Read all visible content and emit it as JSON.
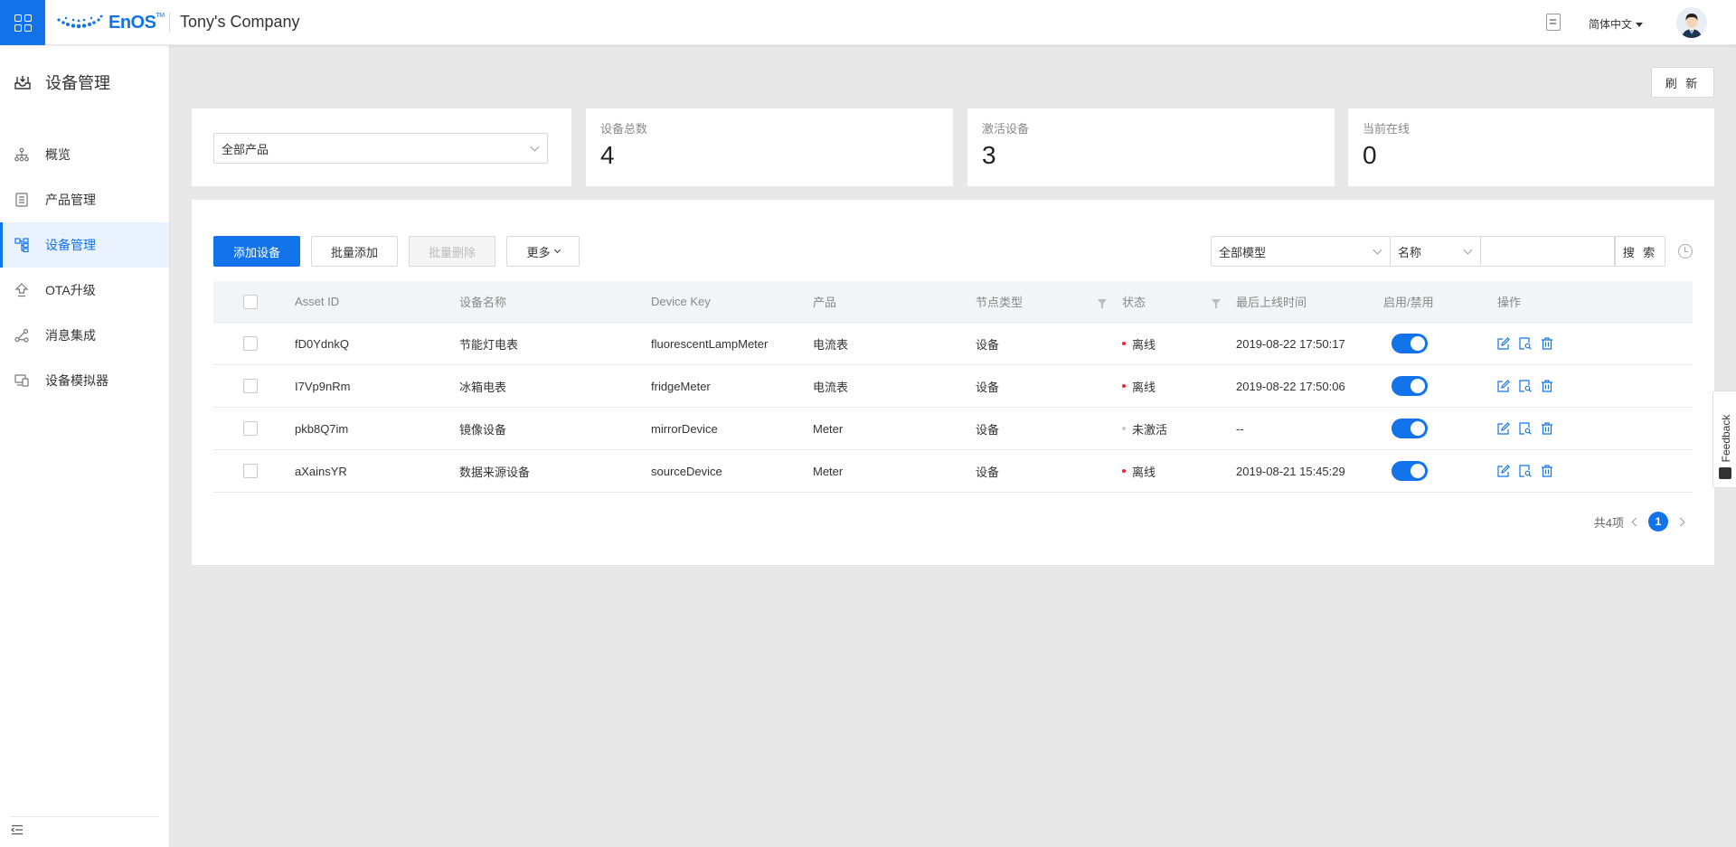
{
  "topbar": {
    "brand": "EnOS",
    "company": "Tony's Company",
    "language": "简体中文"
  },
  "sidebar": {
    "title": "设备管理",
    "items": [
      {
        "label": "概览",
        "icon": "sitemap-icon",
        "active": false
      },
      {
        "label": "产品管理",
        "icon": "list-icon",
        "active": false
      },
      {
        "label": "设备管理",
        "icon": "device-tree-icon",
        "active": true
      },
      {
        "label": "OTA升级",
        "icon": "upload-icon",
        "active": false
      },
      {
        "label": "消息集成",
        "icon": "share-icon",
        "active": false
      },
      {
        "label": "设备模拟器",
        "icon": "devices-icon",
        "active": false
      }
    ]
  },
  "main": {
    "refresh_label": "刷 新",
    "product_filter": "全部产品",
    "stats": [
      {
        "label": "设备总数",
        "value": "4"
      },
      {
        "label": "激活设备",
        "value": "3"
      },
      {
        "label": "当前在线",
        "value": "0"
      }
    ]
  },
  "toolbar": {
    "add_device": "添加设备",
    "batch_add": "批量添加",
    "batch_delete": "批量删除",
    "more": "更多",
    "model_filter": "全部模型",
    "search_field": "名称",
    "search_value": "",
    "search_button": "搜 索"
  },
  "table": {
    "columns": [
      "Asset ID",
      "设备名称",
      "Device Key",
      "产品",
      "节点类型",
      "状态",
      "最后上线时间",
      "启用/禁用",
      "操作"
    ],
    "rows": [
      {
        "asset_id": "fD0YdnkQ",
        "name": "节能灯电表",
        "device_key": "fluorescentLampMeter",
        "product": "电流表",
        "node_type": "设备",
        "status": "离线",
        "status_color": "#f5222d",
        "last_online": "2019-08-22 17:50:17",
        "enabled": true
      },
      {
        "asset_id": "I7Vp9nRm",
        "name": "冰箱电表",
        "device_key": "fridgeMeter",
        "product": "电流表",
        "node_type": "设备",
        "status": "离线",
        "status_color": "#f5222d",
        "last_online": "2019-08-22 17:50:06",
        "enabled": true
      },
      {
        "asset_id": "pkb8Q7im",
        "name": "镜像设备",
        "device_key": "mirrorDevice",
        "product": "Meter",
        "node_type": "设备",
        "status": "未激活",
        "status_color": "#c8c8c8",
        "last_online": "--",
        "enabled": true
      },
      {
        "asset_id": "aXainsYR",
        "name": "数据来源设备",
        "device_key": "sourceDevice",
        "product": "Meter",
        "node_type": "设备",
        "status": "离线",
        "status_color": "#f5222d",
        "last_online": "2019-08-21 15:45:29",
        "enabled": true
      }
    ]
  },
  "pagination": {
    "total": "共4项",
    "current": "1"
  },
  "feedback": {
    "label": "Feedback"
  },
  "colors": {
    "accent": "#1273eb",
    "offline": "#f5222d",
    "inactive": "#c8c8c8"
  }
}
